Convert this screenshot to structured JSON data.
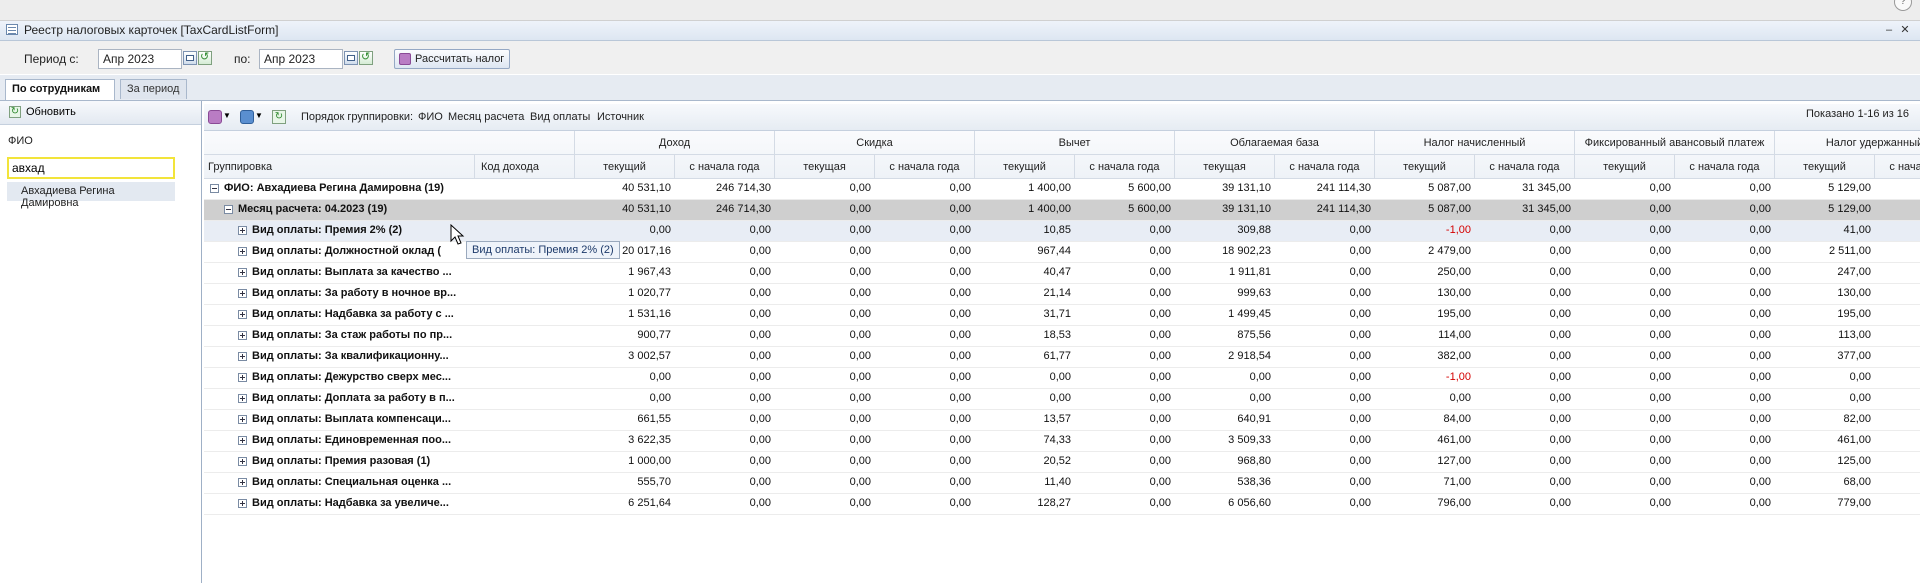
{
  "window": {
    "title": "Реестр налоговых карточек [TaxCardListForm]",
    "minimize_glyph": "–",
    "close_glyph": "✕",
    "help_glyph": "?"
  },
  "toolbar": {
    "period_from_label": "Период с:",
    "period_from_value": "Апр 2023",
    "period_to_label": "по:",
    "period_to_value": "Апр 2023",
    "calc_button_label": "Рассчитать налог"
  },
  "tabs": [
    {
      "label": "По сотрудникам",
      "active": true
    },
    {
      "label": "За период",
      "active": false
    }
  ],
  "left_panel": {
    "refresh_label": "Обновить",
    "fio_label": "ФИО",
    "fio_value": "авхад",
    "result_item": "Авхадиева Регина Дамировна"
  },
  "grid_toolbar": {
    "grouping_label": "Порядок группировки:",
    "grouping_items": [
      "ФИО",
      "Месяц расчета",
      "Вид оплаты",
      "Источник"
    ],
    "shown_text": "Показано 1-16 из 16"
  },
  "columns": {
    "grouping": "Группировка",
    "income_code": "Код дохода",
    "groups": [
      "Доход",
      "Скидка",
      "Вычет",
      "Облагаемая база",
      "Налог начисленный",
      "Фиксированный авансовый платеж",
      "Налог удержанный"
    ],
    "sub": [
      "текущий",
      "с начала года",
      "текущая",
      "с начала года",
      "текущий",
      "с начала года",
      "текущая",
      "с начала года",
      "текущий",
      "с начала года",
      "текущий",
      "с начала года",
      "текущий",
      "с начала года"
    ]
  },
  "rows": [
    {
      "level": 1,
      "name": "ФИО: Авхадиева Регина Дамировна (19)",
      "values": [
        "40 531,10",
        "246 714,30",
        "0,00",
        "0,00",
        "1 400,00",
        "5 600,00",
        "39 131,10",
        "241 114,30",
        "5 087,00",
        "31 345,00",
        "0,00",
        "0,00",
        "5 129,00"
      ]
    },
    {
      "level": 2,
      "name": "Месяц расчета: 04.2023 (19)",
      "values": [
        "40 531,10",
        "246 714,30",
        "0,00",
        "0,00",
        "1 400,00",
        "5 600,00",
        "39 131,10",
        "241 114,30",
        "5 087,00",
        "31 345,00",
        "0,00",
        "0,00",
        "5 129,00"
      ]
    },
    {
      "level": 3,
      "name": "Вид оплаты: Премия 2% (2)",
      "values": [
        "0,00",
        "0,00",
        "0,00",
        "0,00",
        "10,85",
        "0,00",
        "309,88",
        "0,00",
        "-1,00",
        "0,00",
        "0,00",
        "0,00",
        "41,00"
      ]
    },
    {
      "level": 3,
      "name": "Вид оплаты: Должностной оклад (",
      "values": [
        "20 017,16",
        "0,00",
        "0,00",
        "0,00",
        "967,44",
        "0,00",
        "18 902,23",
        "0,00",
        "2 479,00",
        "0,00",
        "0,00",
        "0,00",
        "2 511,00"
      ]
    },
    {
      "level": 3,
      "name": "Вид оплаты: Выплата за качество ...",
      "values": [
        "1 967,43",
        "0,00",
        "0,00",
        "0,00",
        "40,47",
        "0,00",
        "1 911,81",
        "0,00",
        "250,00",
        "0,00",
        "0,00",
        "0,00",
        "247,00"
      ]
    },
    {
      "level": 3,
      "name": "Вид оплаты: За работу в ночное вр...",
      "values": [
        "1 020,77",
        "0,00",
        "0,00",
        "0,00",
        "21,14",
        "0,00",
        "999,63",
        "0,00",
        "130,00",
        "0,00",
        "0,00",
        "0,00",
        "130,00"
      ]
    },
    {
      "level": 3,
      "name": "Вид оплаты: Надбавка за работу с ...",
      "values": [
        "1 531,16",
        "0,00",
        "0,00",
        "0,00",
        "31,71",
        "0,00",
        "1 499,45",
        "0,00",
        "195,00",
        "0,00",
        "0,00",
        "0,00",
        "195,00"
      ]
    },
    {
      "level": 3,
      "name": "Вид оплаты: За стаж работы по пр...",
      "values": [
        "900,77",
        "0,00",
        "0,00",
        "0,00",
        "18,53",
        "0,00",
        "875,56",
        "0,00",
        "114,00",
        "0,00",
        "0,00",
        "0,00",
        "113,00"
      ]
    },
    {
      "level": 3,
      "name": "Вид оплаты: За квалификационну...",
      "values": [
        "3 002,57",
        "0,00",
        "0,00",
        "0,00",
        "61,77",
        "0,00",
        "2 918,54",
        "0,00",
        "382,00",
        "0,00",
        "0,00",
        "0,00",
        "377,00"
      ]
    },
    {
      "level": 3,
      "name": "Вид оплаты: Дежурство сверх мес...",
      "values": [
        "0,00",
        "0,00",
        "0,00",
        "0,00",
        "0,00",
        "0,00",
        "0,00",
        "0,00",
        "-1,00",
        "0,00",
        "0,00",
        "0,00",
        "0,00"
      ]
    },
    {
      "level": 3,
      "name": "Вид оплаты: Доплата за работу в п...",
      "values": [
        "0,00",
        "0,00",
        "0,00",
        "0,00",
        "0,00",
        "0,00",
        "0,00",
        "0,00",
        "0,00",
        "0,00",
        "0,00",
        "0,00",
        "0,00"
      ]
    },
    {
      "level": 3,
      "name": "Вид оплаты: Выплата компенсаци...",
      "values": [
        "661,55",
        "0,00",
        "0,00",
        "0,00",
        "13,57",
        "0,00",
        "640,91",
        "0,00",
        "84,00",
        "0,00",
        "0,00",
        "0,00",
        "82,00"
      ]
    },
    {
      "level": 3,
      "name": "Вид оплаты: Единовременная поо...",
      "values": [
        "3 622,35",
        "0,00",
        "0,00",
        "0,00",
        "74,33",
        "0,00",
        "3 509,33",
        "0,00",
        "461,00",
        "0,00",
        "0,00",
        "0,00",
        "461,00"
      ]
    },
    {
      "level": 3,
      "name": "Вид оплаты: Премия разовая (1)",
      "values": [
        "1 000,00",
        "0,00",
        "0,00",
        "0,00",
        "20,52",
        "0,00",
        "968,80",
        "0,00",
        "127,00",
        "0,00",
        "0,00",
        "0,00",
        "125,00"
      ]
    },
    {
      "level": 3,
      "name": "Вид оплаты: Специальная оценка ...",
      "values": [
        "555,70",
        "0,00",
        "0,00",
        "0,00",
        "11,40",
        "0,00",
        "538,36",
        "0,00",
        "71,00",
        "0,00",
        "0,00",
        "0,00",
        "68,00"
      ]
    },
    {
      "level": 3,
      "name": "Вид оплаты: Надбавка за увеличе...",
      "values": [
        "6 251,64",
        "0,00",
        "0,00",
        "0,00",
        "128,27",
        "0,00",
        "6 056,60",
        "0,00",
        "796,00",
        "0,00",
        "0,00",
        "0,00",
        "779,00"
      ]
    }
  ],
  "tooltip": "Вид оплаты: Премия 2% (2)",
  "colors": {
    "negative": "#d40000",
    "selection": "#cfcfcf",
    "focus_border": "#f2e43a"
  }
}
